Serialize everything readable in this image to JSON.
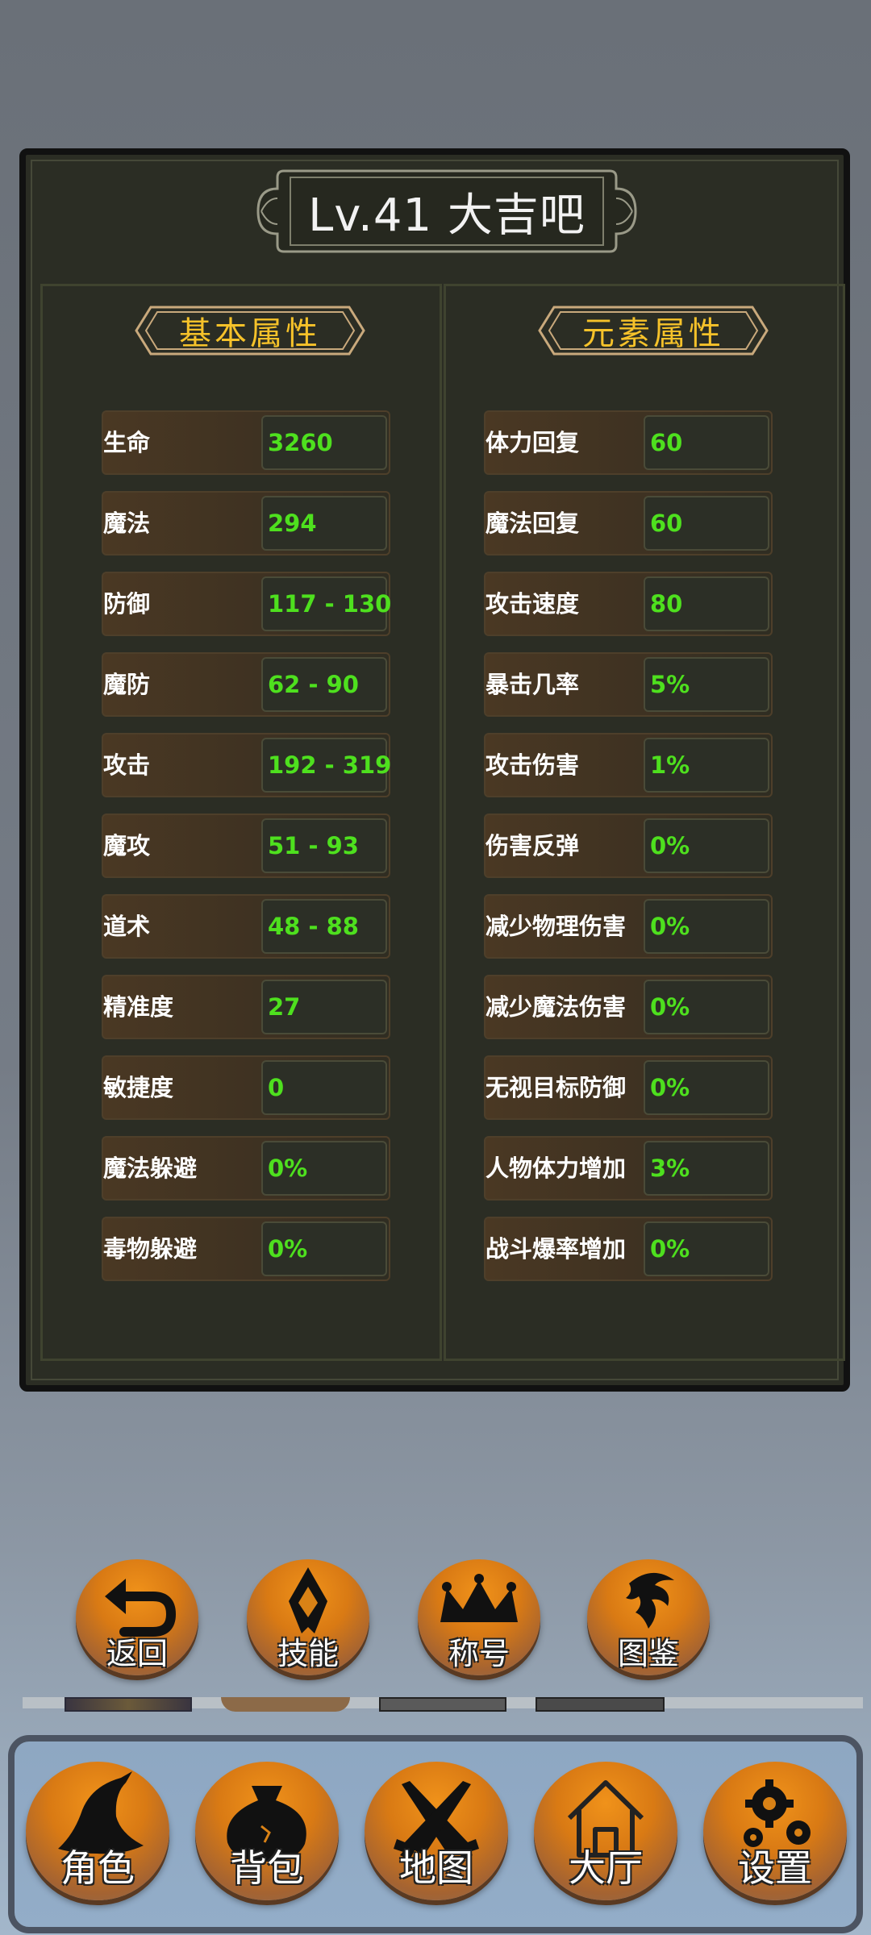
{
  "title": "Lv.41 大吉吧",
  "sections": {
    "basic": "基本属性",
    "element": "元素属性"
  },
  "basic_stats": [
    {
      "label": "生命",
      "value": "3260"
    },
    {
      "label": "魔法",
      "value": "294"
    },
    {
      "label": "防御",
      "value": "117 - 130"
    },
    {
      "label": "魔防",
      "value": "62 - 90"
    },
    {
      "label": "攻击",
      "value": "192 - 319"
    },
    {
      "label": "魔攻",
      "value": "51 - 93"
    },
    {
      "label": "道术",
      "value": "48 - 88"
    },
    {
      "label": "精准度",
      "value": "27"
    },
    {
      "label": "敏捷度",
      "value": "0"
    },
    {
      "label": "魔法躲避",
      "value": "0%"
    },
    {
      "label": "毒物躲避",
      "value": "0%"
    }
  ],
  "element_stats": [
    {
      "label": "体力回复",
      "value": "60"
    },
    {
      "label": "魔法回复",
      "value": "60"
    },
    {
      "label": "攻击速度",
      "value": "80"
    },
    {
      "label": "暴击几率",
      "value": "5%"
    },
    {
      "label": "攻击伤害",
      "value": "1%"
    },
    {
      "label": "伤害反弹",
      "value": "0%"
    },
    {
      "label": "减少物理伤害",
      "value": "0%"
    },
    {
      "label": "减少魔法伤害",
      "value": "0%"
    },
    {
      "label": "无视目标防御",
      "value": "0%"
    },
    {
      "label": "人物体力增加",
      "value": "3%"
    },
    {
      "label": "战斗爆率增加",
      "value": "0%"
    }
  ],
  "action_buttons": [
    {
      "label": "返回",
      "icon": "return-arrow-icon"
    },
    {
      "label": "技能",
      "icon": "skill-emblem-icon"
    },
    {
      "label": "称号",
      "icon": "crown-icon"
    },
    {
      "label": "图鉴",
      "icon": "dragon-icon"
    }
  ],
  "nav_buttons": [
    {
      "label": "角色",
      "icon": "wizard-hat-icon"
    },
    {
      "label": "背包",
      "icon": "bag-icon"
    },
    {
      "label": "地图",
      "icon": "crossed-swords-icon"
    },
    {
      "label": "大厅",
      "icon": "house-icon"
    },
    {
      "label": "设置",
      "icon": "gears-icon"
    }
  ],
  "colors": {
    "panel_bg": "#2b2d24",
    "value_green": "#4ee01e",
    "section_gold": "#f6c22a",
    "button_orange": "#f0921a"
  }
}
